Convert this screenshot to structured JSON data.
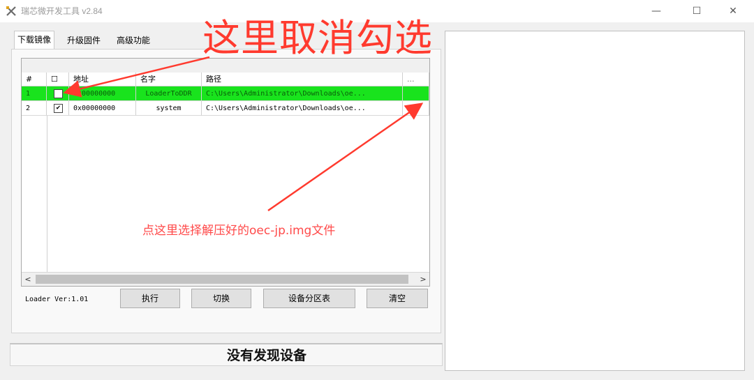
{
  "window": {
    "title": "瑞芯微开发工具 v2.84",
    "controls": {
      "minimize": "—",
      "maximize": "☐",
      "close": "✕"
    }
  },
  "tabs": [
    {
      "label": "下载镜像",
      "active": true
    },
    {
      "label": "升级固件",
      "active": false
    },
    {
      "label": "高级功能",
      "active": false
    }
  ],
  "table": {
    "headers": {
      "index": "#",
      "check": "☐",
      "address": "地址",
      "name": "名字",
      "path": "路径",
      "browse": "..."
    },
    "rows": [
      {
        "index": "1",
        "checked": false,
        "check_mark": "",
        "address": "0x00000000",
        "name": "LoaderToDDR",
        "path": "C:\\Users\\Administrator\\Downloads\\oe...",
        "highlight": "#19e31d"
      },
      {
        "index": "2",
        "checked": true,
        "check_mark": "✔",
        "address": "0x00000000",
        "name": "system",
        "path": "C:\\Users\\Administrator\\Downloads\\oe...",
        "highlight": ""
      }
    ],
    "scroll": {
      "left_arrow": "<",
      "right_arrow": ">"
    }
  },
  "footer": {
    "loader_version": "Loader Ver:1.01",
    "buttons": {
      "run": "执行",
      "switch": "切换",
      "partition_table": "设备分区表",
      "clear": "清空"
    }
  },
  "status": {
    "text": "没有发现设备"
  },
  "annotations": {
    "uncheck_here": "这里取消勾选",
    "choose_file": "点这里选择解压好的oec-jp.img文件",
    "color": "#ff3a2e"
  }
}
